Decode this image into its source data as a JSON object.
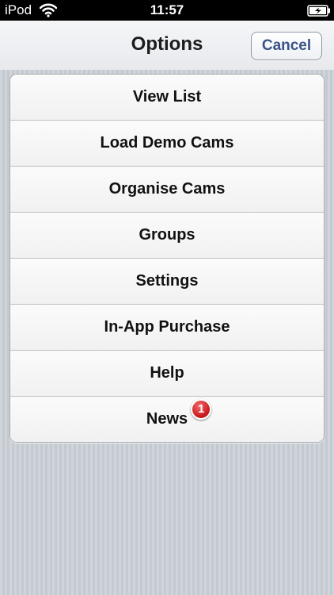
{
  "status_bar": {
    "carrier": "iPod",
    "time": "11:57",
    "wifi_icon": "wifi-icon",
    "battery_icon": "battery-charging-icon"
  },
  "nav_bar": {
    "title": "Options",
    "cancel_label": "Cancel"
  },
  "options": {
    "items": [
      {
        "label": "View List"
      },
      {
        "label": "Load Demo Cams"
      },
      {
        "label": "Organise Cams"
      },
      {
        "label": "Groups"
      },
      {
        "label": "Settings"
      },
      {
        "label": "In-App Purchase"
      },
      {
        "label": "Help"
      },
      {
        "label": "News",
        "badge": "1"
      }
    ]
  },
  "colors": {
    "cancel_text": "#3a5488",
    "badge": "#c8161a",
    "background": "#cbd0d8"
  }
}
